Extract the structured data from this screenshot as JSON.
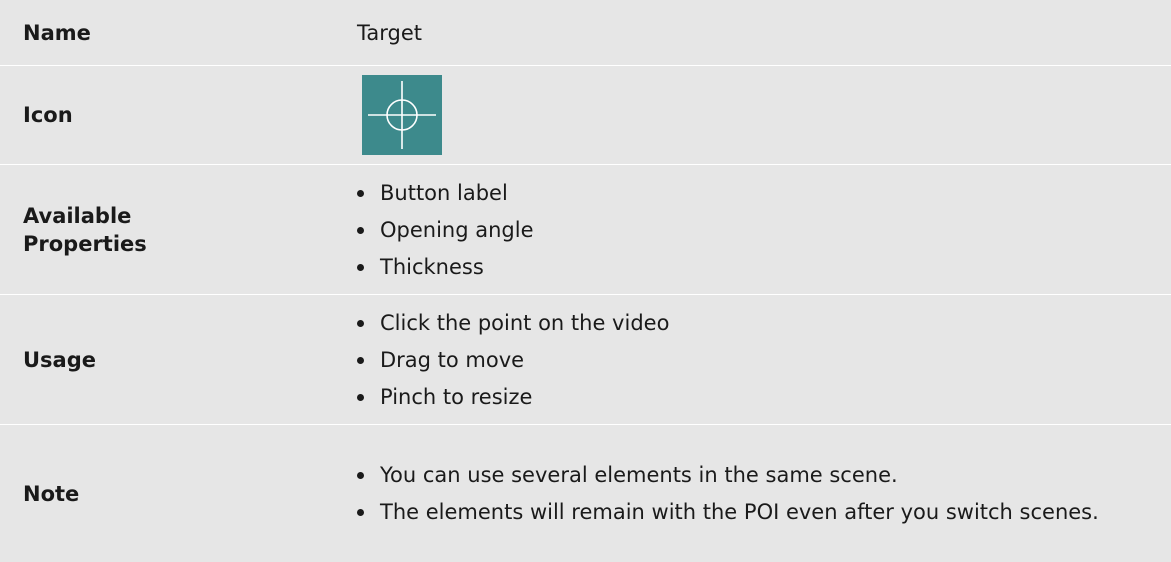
{
  "rows": {
    "name": {
      "label": "Name",
      "value": "Target"
    },
    "icon": {
      "label": "Icon",
      "icon_name": "crosshair-icon",
      "icon_bg": "#3d8a8c"
    },
    "properties": {
      "label_line1": "Available",
      "label_line2": "Properties",
      "items": [
        "Button label",
        "Opening angle",
        "Thickness"
      ]
    },
    "usage": {
      "label": "Usage",
      "items": [
        "Click the point on the video",
        "Drag to move",
        "Pinch to resize"
      ]
    },
    "note": {
      "label": "Note",
      "items": [
        "You can use several elements in the same scene.",
        "The elements will remain with the POI even after you switch scenes."
      ]
    }
  }
}
